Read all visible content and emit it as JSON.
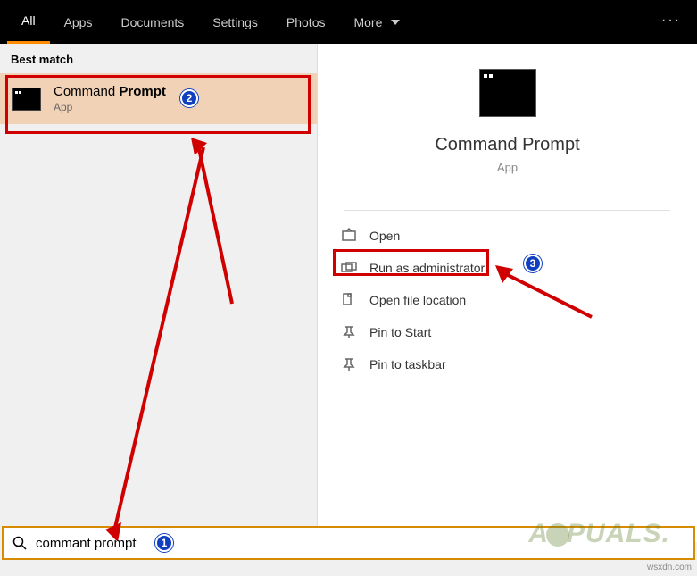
{
  "topbar": {
    "tabs": [
      "All",
      "Apps",
      "Documents",
      "Settings",
      "Photos",
      "More"
    ],
    "active_index": 0
  },
  "left": {
    "section_label": "Best match",
    "result": {
      "title_pre": "Command ",
      "title_bold": "Prompt",
      "subtitle": "App"
    }
  },
  "right": {
    "title": "Command Prompt",
    "subtitle": "App",
    "actions": [
      {
        "label": "Open",
        "icon": "open"
      },
      {
        "label": "Run as administrator",
        "icon": "admin"
      },
      {
        "label": "Open file location",
        "icon": "folder"
      },
      {
        "label": "Pin to Start",
        "icon": "pin"
      },
      {
        "label": "Pin to taskbar",
        "icon": "pin"
      }
    ]
  },
  "search": {
    "value": "commant prompt"
  },
  "badges": {
    "b1": "1",
    "b2": "2",
    "b3": "3"
  },
  "watermark": {
    "pre": "A",
    "mid": "PUALS",
    "suf": "."
  },
  "credit": "wsxdn.com"
}
